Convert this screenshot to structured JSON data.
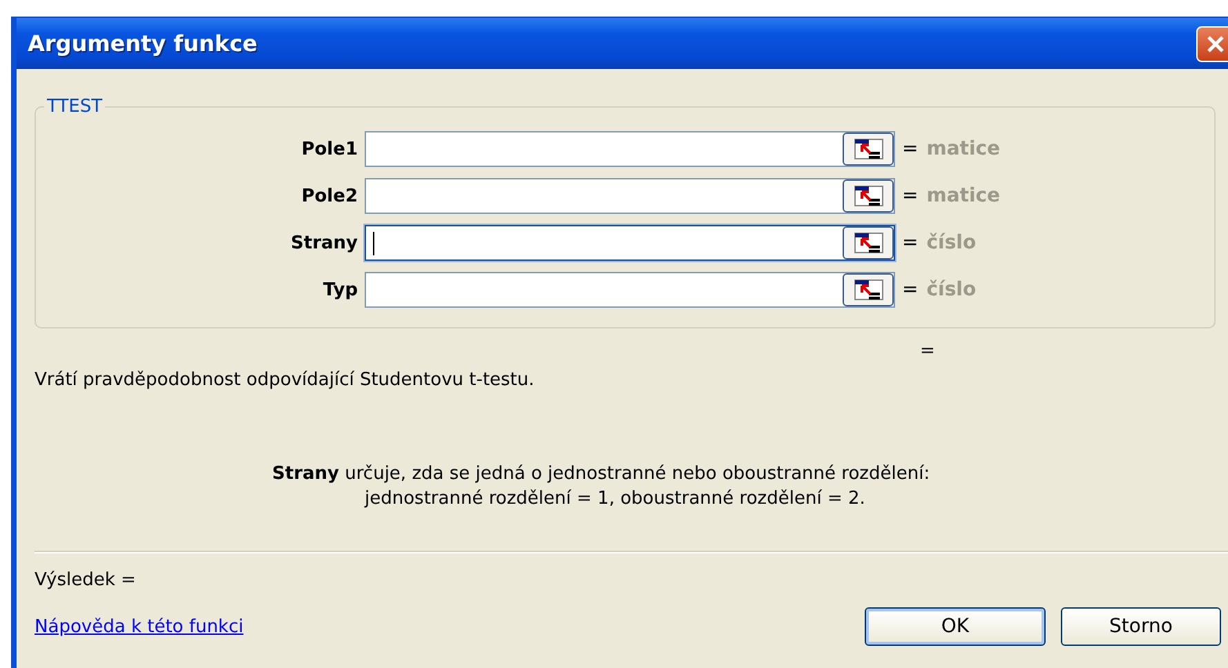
{
  "window": {
    "title": "Argumenty funkce"
  },
  "function_group": {
    "name": "TTEST",
    "arguments": [
      {
        "label": "Pole1",
        "focused": false,
        "equals": "=",
        "hint": "matice"
      },
      {
        "label": "Pole2",
        "focused": false,
        "equals": "=",
        "hint": "matice"
      },
      {
        "label": "Strany",
        "focused": true,
        "equals": "=",
        "hint": "číslo"
      },
      {
        "label": "Typ",
        "focused": false,
        "equals": "=",
        "hint": "číslo"
      }
    ]
  },
  "formula_result": "=",
  "description": "Vrátí pravděpodobnost odpovídající Studentovu t-testu.",
  "argument_help": [
    "**Strany** určuje, zda se jedná o jednostranné nebo oboustranné rozdělení:",
    "jednostranné rozdělení = 1, oboustranné rozdělení = 2."
  ],
  "result_label": "Výsledek =",
  "help_link": "Nápověda k této funkci",
  "buttons": [
    {
      "label": "OK",
      "default": true
    },
    {
      "label": "Storno",
      "default": false
    }
  ]
}
